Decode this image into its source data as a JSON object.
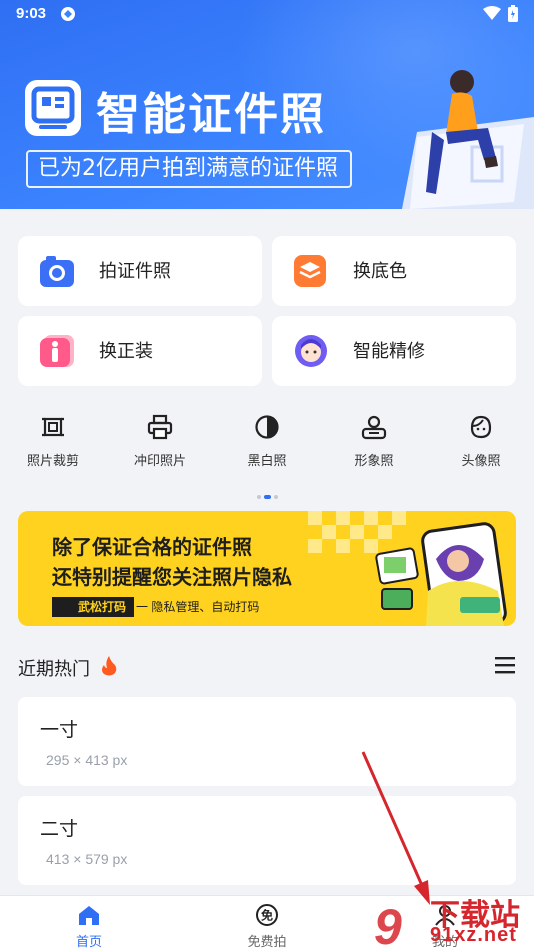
{
  "status_bar": {
    "time": "9:03"
  },
  "hero": {
    "title": "智能证件照",
    "subtitle": "已为2亿用户拍到满意的证件照"
  },
  "cards": [
    {
      "label": "拍证件照",
      "icon": "camera-icon",
      "color": "#3b6ff5"
    },
    {
      "label": "换底色",
      "icon": "layers-icon",
      "color": "#ff7a33"
    },
    {
      "label": "换正装",
      "icon": "suit-icon",
      "color": "#ff5a8a"
    },
    {
      "label": "智能精修",
      "icon": "face-icon",
      "color": "#6f5cf3"
    }
  ],
  "tools": [
    {
      "label": "照片裁剪",
      "icon": "crop-icon"
    },
    {
      "label": "冲印照片",
      "icon": "printer-icon"
    },
    {
      "label": "黑白照",
      "icon": "contrast-icon"
    },
    {
      "label": "形象照",
      "icon": "portrait-icon"
    },
    {
      "label": "头像照",
      "icon": "avatar-face-icon"
    }
  ],
  "promo": {
    "line1": "除了保证合格的证件照",
    "line2": "还特别提醒您关注照片隐私",
    "tag": "武松打码",
    "tag_desc": "一 隐私管理、自动打码"
  },
  "section": {
    "title": "近期热门"
  },
  "sizes": [
    {
      "name": "一寸",
      "dims": "295 × 413 px"
    },
    {
      "name": "二寸",
      "dims": "413 × 579 px"
    }
  ],
  "nav": [
    {
      "label": "首页",
      "icon": "home-icon",
      "active": true
    },
    {
      "label": "免费拍",
      "icon": "free-icon",
      "active": false
    },
    {
      "label": "我的",
      "icon": "user-icon",
      "active": false
    }
  ],
  "watermark": {
    "brand": "下载站",
    "domain": "91xz.net",
    "number": "9"
  },
  "colors": {
    "primary": "#2f6ff3",
    "promo_bg": "#ffd21f",
    "annotation_arrow": "#d6262d"
  }
}
